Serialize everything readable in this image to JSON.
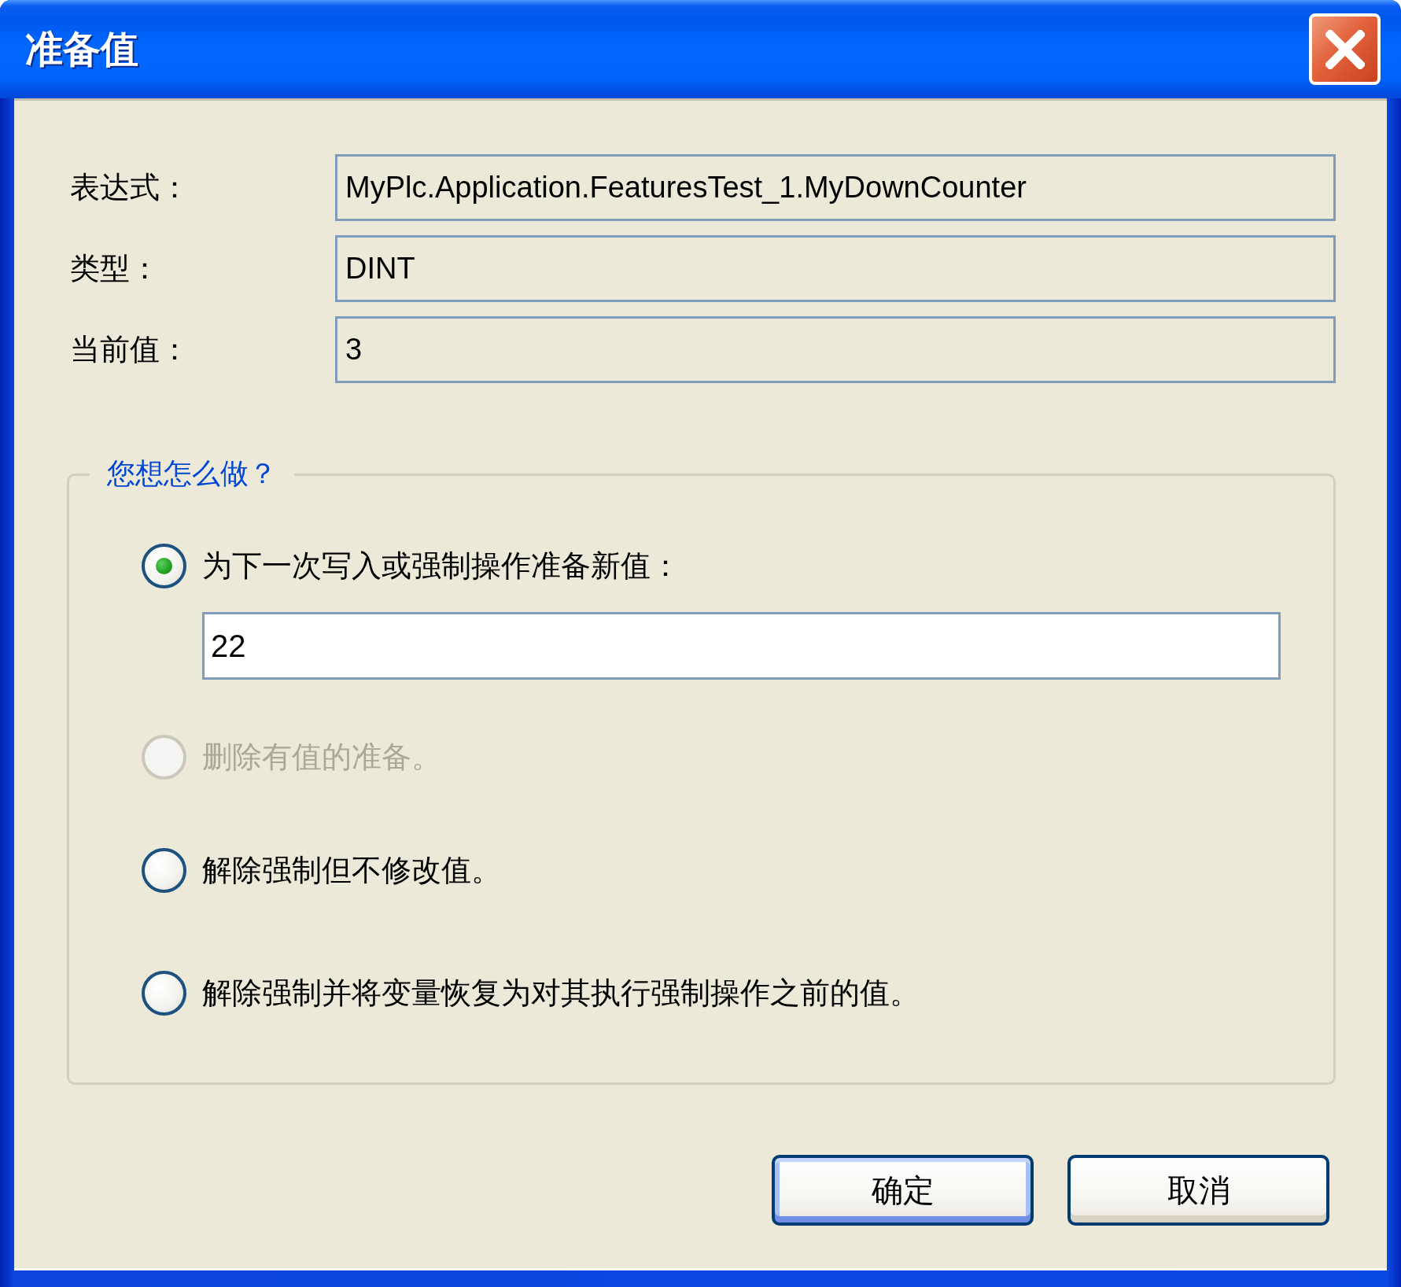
{
  "window": {
    "title": "准备值"
  },
  "fields": [
    {
      "label": "表达式：",
      "value": "MyPlc.Application.FeaturesTest_1.MyDownCounter"
    },
    {
      "label": "类型：",
      "value": "DINT"
    },
    {
      "label": "当前值：",
      "value": "3"
    }
  ],
  "group": {
    "title": "您想怎么做？",
    "options": [
      {
        "label": "为下一次写入或强制操作准备新值：",
        "selected": true,
        "disabled": false,
        "input": {
          "value": "22"
        }
      },
      {
        "label": "删除有值的准备。",
        "selected": false,
        "disabled": true
      },
      {
        "label": "解除强制但不修改值。",
        "selected": false,
        "disabled": false
      },
      {
        "label": "解除强制并将变量恢复为对其执行强制操作之前的值。",
        "selected": false,
        "disabled": false
      }
    ]
  },
  "buttons": [
    {
      "label": "确定",
      "default": true
    },
    {
      "label": "取消",
      "default": false
    }
  ]
}
